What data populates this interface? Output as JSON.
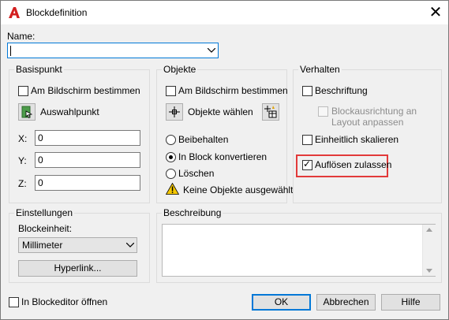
{
  "window": {
    "title": "Blockdefinition"
  },
  "name": {
    "label": "Name:",
    "value": ""
  },
  "basispunkt": {
    "title": "Basispunkt",
    "onscreen_label": "Am Bildschirm bestimmen",
    "pick_label": "Auswahlpunkt",
    "x_label": "X:",
    "x_value": "0",
    "y_label": "Y:",
    "y_value": "0",
    "z_label": "Z:",
    "z_value": "0"
  },
  "objekte": {
    "title": "Objekte",
    "onscreen_label": "Am Bildschirm bestimmen",
    "select_label": "Objekte wählen",
    "retain_label": "Beibehalten",
    "convert_label": "In Block konvertieren",
    "delete_label": "Löschen",
    "warning": "Keine Objekte ausgewählt",
    "selected_option": "convert"
  },
  "verhalten": {
    "title": "Verhalten",
    "annotative_label": "Beschriftung",
    "match_orientation_label_1": "Blockausrichtung an",
    "match_orientation_label_2": "Layout anpassen",
    "uniform_scale_label": "Einheitlich skalieren",
    "allow_explode_label": "Auflösen zulassen",
    "allow_explode_checked": true
  },
  "einstellungen": {
    "title": "Einstellungen",
    "unit_label": "Blockeinheit:",
    "unit_value": "Millimeter",
    "hyperlink_label": "Hyperlink..."
  },
  "beschreibung": {
    "title": "Beschreibung",
    "value": ""
  },
  "footer": {
    "open_editor_label": "In Blockeditor öffnen",
    "ok_label": "OK",
    "cancel_label": "Abbrechen",
    "help_label": "Hilfe"
  },
  "colors": {
    "highlight": "#e23a3a",
    "accent": "#0078d7",
    "title_icon": "#d32020"
  }
}
